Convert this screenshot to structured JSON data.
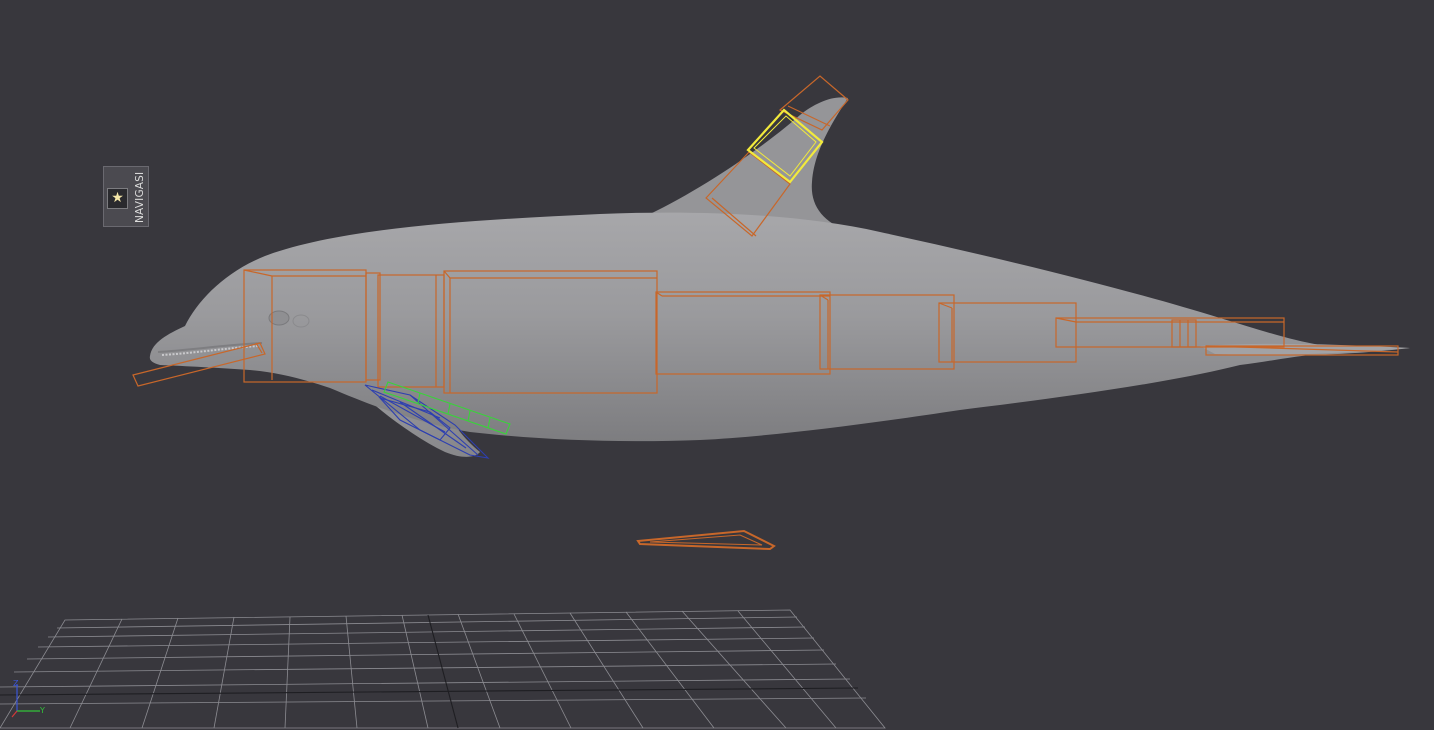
{
  "navigation_panel": {
    "label": "NAVIGASI",
    "icon": "star-icon"
  },
  "axis_gizmo": {
    "z_label": "Z",
    "y_label": "Y",
    "colors": {
      "z": "#3b55d6",
      "y": "#32c23a",
      "x": "#d23a3a"
    }
  },
  "scene": {
    "model": "dolphin",
    "colors": {
      "background": "#38373d",
      "rig_boxes": "#c8672a",
      "selected_control": "#f2ea3c",
      "fin_rig_blue": "#2d3fb0",
      "fin_rig_green": "#39d33a",
      "grid": "#8c8c92"
    }
  }
}
